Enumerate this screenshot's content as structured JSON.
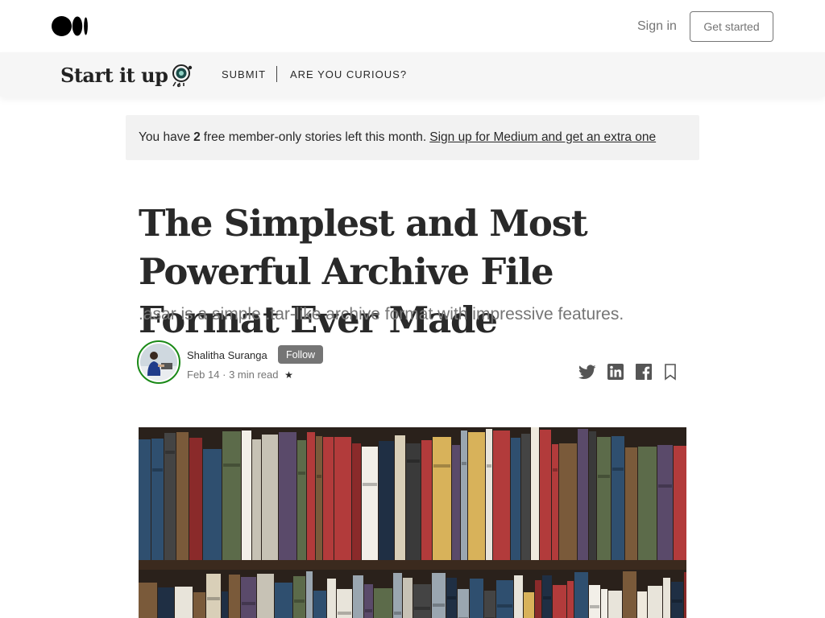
{
  "topbar": {
    "logo_icon": "medium-logo-icon",
    "signin_label": "Sign in",
    "get_started_label": "Get started"
  },
  "publication": {
    "name": "Start it up",
    "logo_icon": "rocket-icon",
    "nav": [
      {
        "label": "SUBMIT"
      },
      {
        "label": "ARE YOU CURIOUS?"
      }
    ]
  },
  "banner": {
    "prefix": "You have",
    "count": "2",
    "suffix": "free member-only stories left this month.",
    "link": "Sign up for Medium and get an extra one"
  },
  "article": {
    "title": "The Simplest and Most Powerful Archive File Format Ever Made",
    "subtitle": ".asar is a simple .tar-like archive format with impressive features.",
    "author": "Shalitha Suranga",
    "follow_label": "Follow",
    "date": "Feb 14",
    "separator": "·",
    "read_time": "3 min read",
    "member_icon": "star-icon",
    "hero_image": "bookshelf-photo"
  },
  "share": [
    "twitter-icon",
    "linkedin-icon",
    "facebook-icon",
    "bookmark-icon"
  ],
  "colors": {
    "accent_green": "#1a8917",
    "muted_text": "#757575",
    "banner_bg": "#f2f2f2",
    "pubbar_bg": "#f6f6f6"
  }
}
